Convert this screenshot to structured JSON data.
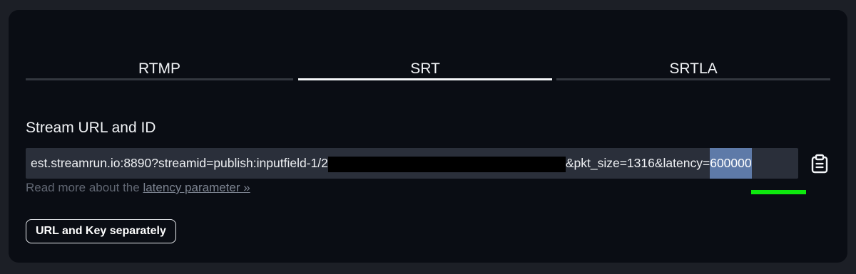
{
  "tabs": [
    {
      "label": "RTMP",
      "active": false
    },
    {
      "label": "SRT",
      "active": true
    },
    {
      "label": "SRTLA",
      "active": false
    }
  ],
  "stream": {
    "label": "Stream URL and ID",
    "url_prefix": "est.streamrun.io:8890?streamid=publish:inputfield-1/2",
    "url_suffix": "&pkt_size=1316&latency=",
    "url_selected": "600000"
  },
  "help": {
    "text": "Read more about the ",
    "link": "latency parameter »"
  },
  "buttons": {
    "separate": "URL and Key separately"
  },
  "icons": {
    "copy": "clipboard-icon"
  },
  "colors": {
    "background": "#0a0d14",
    "highlight": "#5e7aa8",
    "annotation": "#0ee80e"
  }
}
